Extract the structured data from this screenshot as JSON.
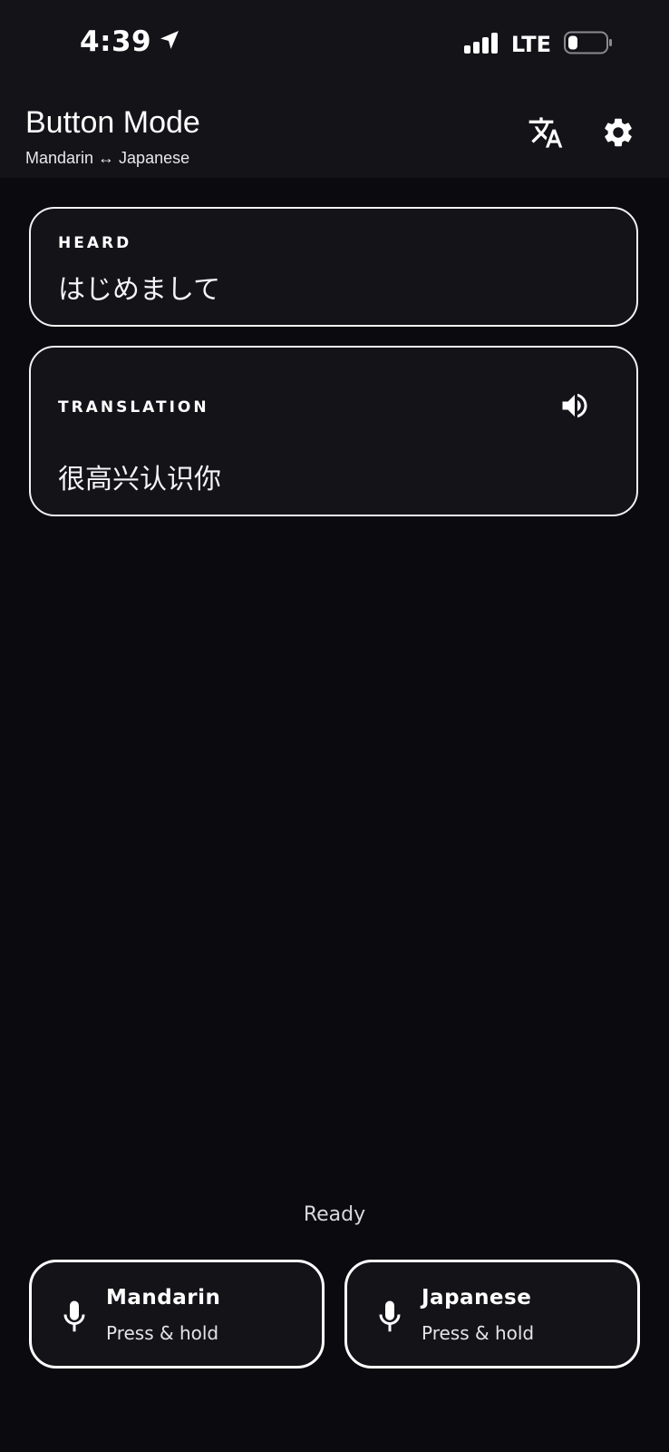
{
  "status_bar": {
    "time": "4:39",
    "network": "LTE",
    "icons": [
      "location-arrow-icon",
      "cellular-signal-icon",
      "battery-icon"
    ]
  },
  "header": {
    "title": "Button Mode",
    "subtitle": "Mandarin ↔ Japanese",
    "icons": [
      "translate-icon",
      "gear-icon"
    ]
  },
  "heard": {
    "label": "HEARD",
    "text": "はじめまして"
  },
  "translation": {
    "label": "TRANSLATION",
    "text": "很高兴认识你",
    "icon": "speaker-icon"
  },
  "status_text": "Ready",
  "buttons": [
    {
      "language": "Mandarin",
      "hint": "Press & hold",
      "icon": "microphone-icon"
    },
    {
      "language": "Japanese",
      "hint": "Press & hold",
      "icon": "microphone-icon"
    }
  ],
  "colors": {
    "background": "#0b0b0f",
    "surface": "#131318",
    "border": "#f2f2f4",
    "text": "#ffffff"
  }
}
